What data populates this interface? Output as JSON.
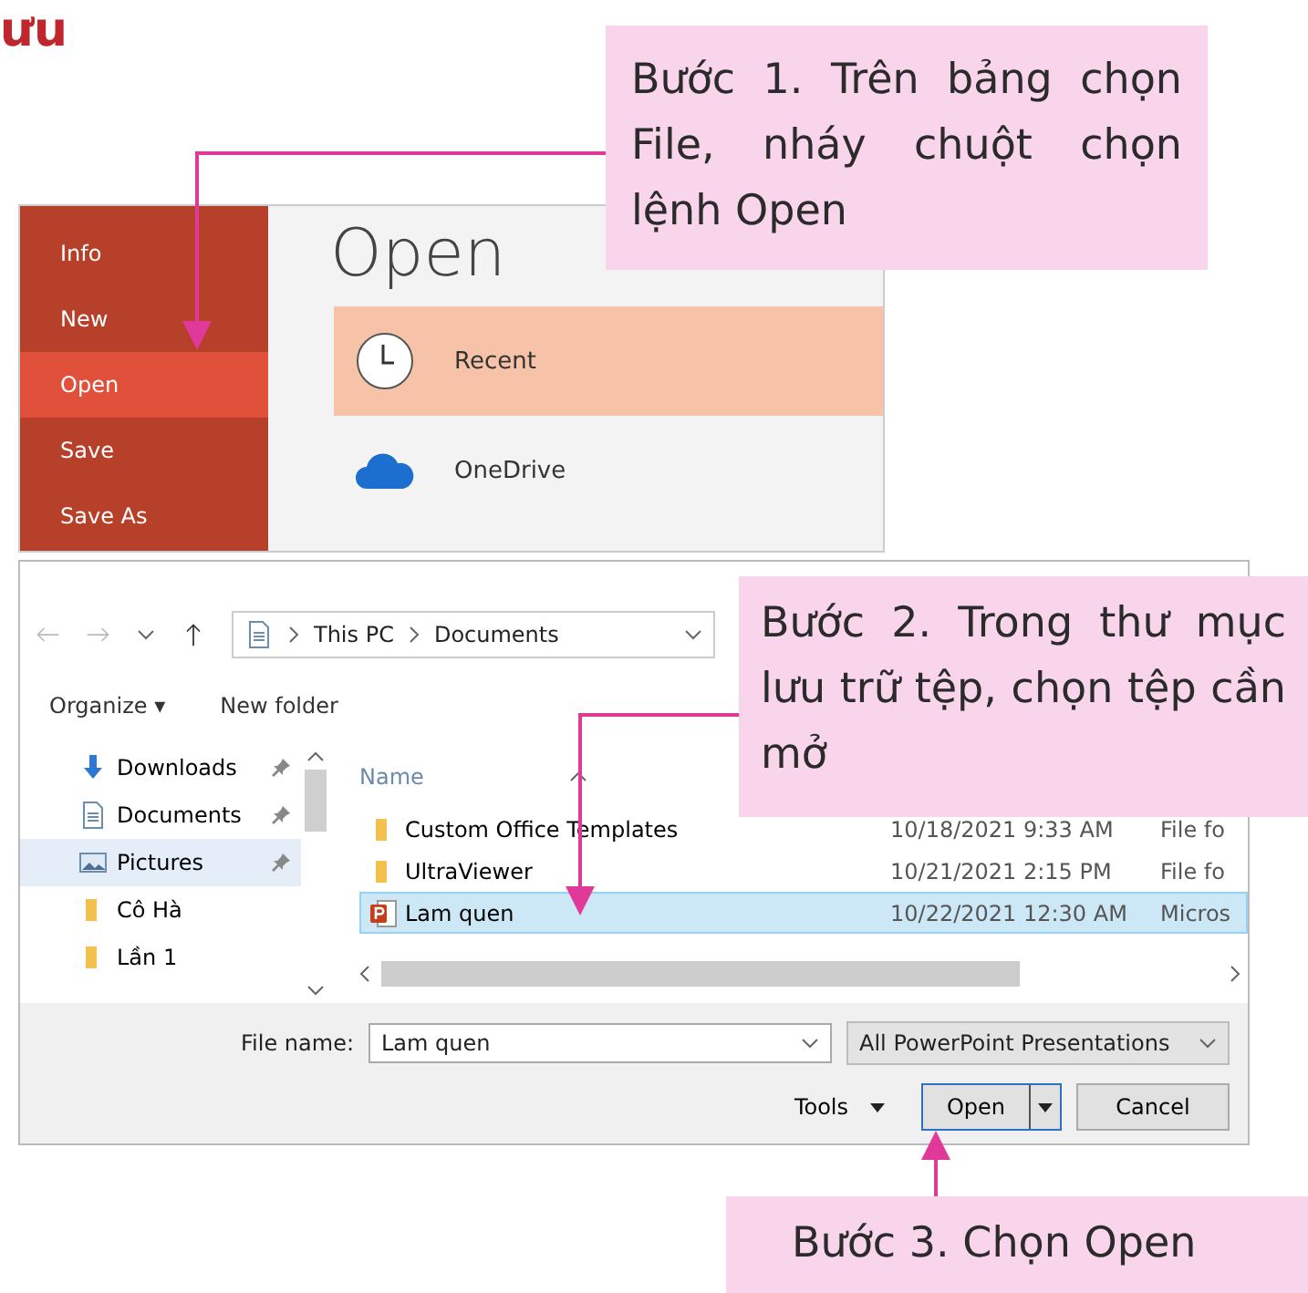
{
  "heading": "ưu",
  "backstage": {
    "menu": [
      {
        "label": "Info",
        "selected": false
      },
      {
        "label": "New",
        "selected": false
      },
      {
        "label": "Open",
        "selected": true
      },
      {
        "label": "Save",
        "selected": false
      },
      {
        "label": "Save As",
        "selected": false
      }
    ],
    "title": "Open",
    "places": [
      {
        "label": "Recent",
        "kind": "clock",
        "selected": true
      },
      {
        "label": "OneDrive",
        "kind": "cloud",
        "selected": false
      }
    ]
  },
  "dialog": {
    "path": [
      "This PC",
      "Documents"
    ],
    "toolbar": {
      "organize": "Organize ▾",
      "new_folder": "New folder"
    },
    "nav": [
      {
        "label": "Downloads",
        "kind": "download",
        "pinned": true,
        "selected": false
      },
      {
        "label": "Documents",
        "kind": "document",
        "pinned": true,
        "selected": false
      },
      {
        "label": "Pictures",
        "kind": "pictures",
        "pinned": true,
        "selected": true
      },
      {
        "label": "Cô Hà",
        "kind": "folder",
        "pinned": false,
        "selected": false
      },
      {
        "label": "Lần 1",
        "kind": "folder",
        "pinned": false,
        "selected": false
      }
    ],
    "column_1": "Name",
    "files": [
      {
        "name": "Custom Office Templates",
        "kind": "folder",
        "date": "10/18/2021 9:33 AM",
        "type": "File fo",
        "selected": false
      },
      {
        "name": "UltraViewer",
        "kind": "folder",
        "date": "10/21/2021 2:15 PM",
        "type": "File fo",
        "selected": false
      },
      {
        "name": "Lam quen",
        "kind": "presentation",
        "date": "10/22/2021 12:30 AM",
        "type": "Micros",
        "selected": true
      }
    ],
    "file_name_label": "File name:",
    "file_name": "Lam quen",
    "filter": "All PowerPoint Presentations",
    "tools": "Tools",
    "open": "Open",
    "cancel": "Cancel"
  },
  "callouts": [
    "Bước 1. Trên bảng chọn File, nháy chuột chọn lệnh Open",
    "Bước 2. Trong thư mục lưu trữ tệp, chọn tệp cần mở",
    "Bước 3. Chọn Open"
  ]
}
